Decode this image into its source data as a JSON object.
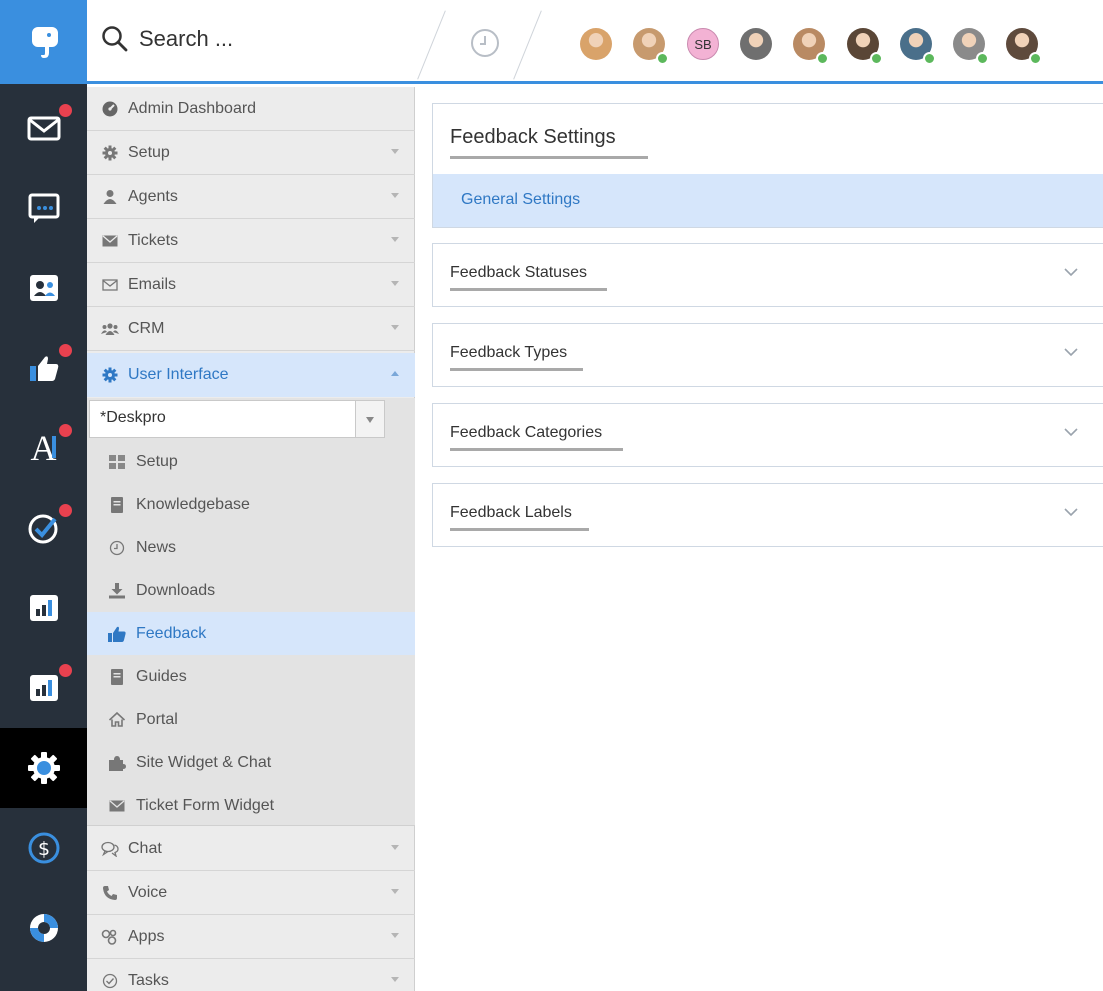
{
  "topbar": {
    "search_label": "Search ...",
    "avatars": [
      {
        "name": "agent-1",
        "initials": "",
        "online": false,
        "color": "#d9a36a"
      },
      {
        "name": "agent-2",
        "initials": "",
        "online": true,
        "color": "#c79a6e"
      },
      {
        "name": "agent-3",
        "initials": "SB",
        "online": false,
        "color": "#f3b2d4"
      },
      {
        "name": "agent-4",
        "initials": "",
        "online": false,
        "color": "#6f6f6f"
      },
      {
        "name": "agent-5",
        "initials": "",
        "online": true,
        "color": "#b98a63"
      },
      {
        "name": "agent-6",
        "initials": "",
        "online": true,
        "color": "#5a4636"
      },
      {
        "name": "agent-7",
        "initials": "",
        "online": true,
        "color": "#4a6f8a"
      },
      {
        "name": "agent-8",
        "initials": "",
        "online": true,
        "color": "#8a8a8a"
      },
      {
        "name": "agent-9",
        "initials": "",
        "online": true,
        "color": "#5e4a3c"
      }
    ]
  },
  "rail": {
    "items": [
      {
        "name": "tickets",
        "icon": "envelope-icon",
        "badge": true
      },
      {
        "name": "chat",
        "icon": "chat-icon",
        "badge": false
      },
      {
        "name": "crm",
        "icon": "contacts-icon",
        "badge": false
      },
      {
        "name": "feedback",
        "icon": "thumbs-up-icon",
        "badge": true
      },
      {
        "name": "publish",
        "icon": "publish-icon",
        "glyph": "A",
        "badge": true
      },
      {
        "name": "tasks",
        "icon": "check-icon",
        "badge": true
      },
      {
        "name": "reports",
        "icon": "reports-icon",
        "badge": false
      },
      {
        "name": "reports-2",
        "icon": "reports-icon",
        "badge": true
      },
      {
        "name": "admin",
        "icon": "gear-icon",
        "badge": false,
        "active": true
      },
      {
        "name": "billing",
        "icon": "dollar-icon",
        "badge": false
      },
      {
        "name": "help",
        "icon": "lifebuoy-icon",
        "badge": false
      }
    ]
  },
  "nav": {
    "items": [
      {
        "label": "Admin Dashboard",
        "icon": "dashboard-icon",
        "caret": false
      },
      {
        "label": "Setup",
        "icon": "gear-icon",
        "caret": true
      },
      {
        "label": "Agents",
        "icon": "user-icon",
        "caret": true
      },
      {
        "label": "Tickets",
        "icon": "envelope-icon",
        "caret": true
      },
      {
        "label": "Emails",
        "icon": "envelope-outline-icon",
        "caret": true
      },
      {
        "label": "CRM",
        "icon": "users-icon",
        "caret": true
      },
      {
        "label": "User Interface",
        "icon": "gear-icon",
        "caret": true,
        "open": true
      }
    ],
    "brand_select": "*Deskpro",
    "sub_items": [
      {
        "label": "Setup",
        "icon": "grid-icon"
      },
      {
        "label": "Knowledgebase",
        "icon": "book-icon"
      },
      {
        "label": "News",
        "icon": "clock-icon"
      },
      {
        "label": "Downloads",
        "icon": "download-icon"
      },
      {
        "label": "Feedback",
        "icon": "thumbs-up-icon",
        "active": true
      },
      {
        "label": "Guides",
        "icon": "book-icon"
      },
      {
        "label": "Portal",
        "icon": "home-icon"
      },
      {
        "label": "Site Widget & Chat",
        "icon": "puzzle-icon"
      },
      {
        "label": "Ticket Form Widget",
        "icon": "envelope-icon"
      }
    ],
    "bottom_items": [
      {
        "label": "Chat",
        "icon": "chat-outline-icon"
      },
      {
        "label": "Voice",
        "icon": "phone-icon"
      },
      {
        "label": "Apps",
        "icon": "apps-icon"
      },
      {
        "label": "Tasks",
        "icon": "check-circle-icon"
      }
    ]
  },
  "main": {
    "title": "Feedback Settings",
    "tab": "General Settings",
    "sections": [
      {
        "label": "Feedback Statuses"
      },
      {
        "label": "Feedback Types"
      },
      {
        "label": "Feedback Categories"
      },
      {
        "label": "Feedback Labels"
      }
    ]
  },
  "colors": {
    "accent": "#3a8fdf",
    "rail_bg": "#27303b",
    "badge": "#e8414f",
    "online": "#5cb85c",
    "selected_bg": "#d6e6fb",
    "selected_text": "#2f78c4"
  }
}
